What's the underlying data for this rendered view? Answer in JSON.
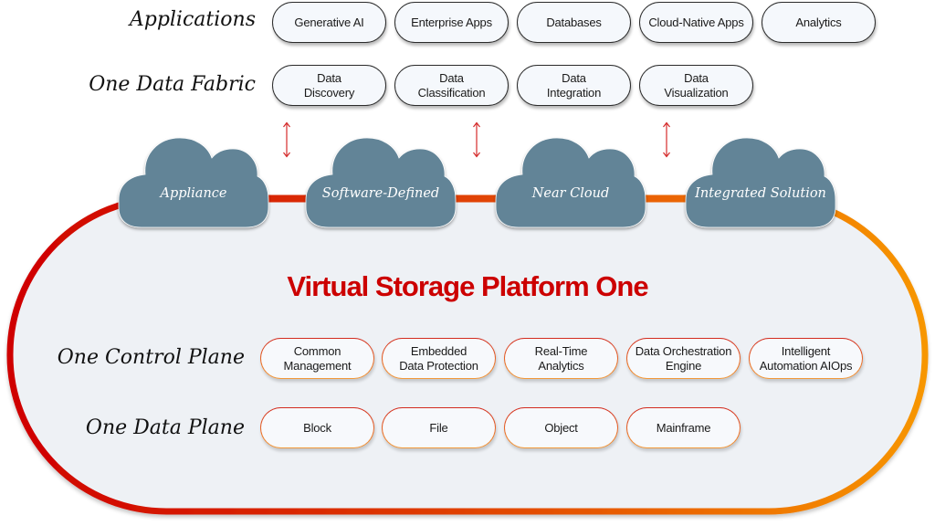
{
  "colors": {
    "accent_red": "#cc0000",
    "accent_orange": "#f28c00",
    "cloud": "#628497",
    "platform_fill": "#eef1f5"
  },
  "applications": {
    "label": "Applications",
    "items": [
      "Generative AI",
      "Enterprise Apps",
      "Databases",
      "Cloud-Native Apps",
      "Analytics"
    ]
  },
  "data_fabric": {
    "label": "One Data Fabric",
    "items": [
      "Data\nDiscovery",
      "Data\nClassification",
      "Data\nIntegration",
      "Data\nVisualization"
    ]
  },
  "arrows": [
    {
      "icon": "double-arrow-vertical-icon"
    },
    {
      "icon": "double-arrow-vertical-icon"
    },
    {
      "icon": "double-arrow-vertical-icon"
    }
  ],
  "clouds": [
    "Appliance",
    "Software-Defined",
    "Near Cloud",
    "Integrated Solution"
  ],
  "platform": {
    "title": "Virtual Storage Platform One"
  },
  "control_plane": {
    "label": "One Control Plane",
    "items": [
      "Common\nManagement",
      "Embedded\nData Protection",
      "Real-Time\nAnalytics",
      "Data Orchestration\nEngine",
      "Intelligent\nAutomation AIOps"
    ]
  },
  "data_plane": {
    "label": "One Data Plane",
    "items": [
      "Block",
      "File",
      "Object",
      "Mainframe"
    ]
  }
}
